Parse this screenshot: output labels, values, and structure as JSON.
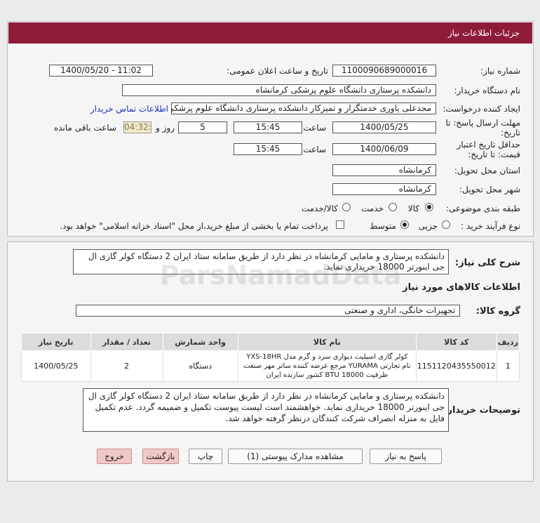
{
  "page": {
    "title": "جزئیات اطلاعات نیاز"
  },
  "form": {
    "need_number": {
      "label": "شماره نیاز:",
      "value": "1100090689000016"
    },
    "announce_datetime": {
      "label": "تاریخ و ساعت اعلان عمومی:",
      "value": "1400/05/20 - 11:02"
    },
    "buyer_org": {
      "label": "نام دستگاه خریدار:",
      "value": "دانشکده پرستاری دانشگاه علوم پزشکی کرمانشاه"
    },
    "requester": {
      "label": "ایجاد کننده درخواست:",
      "value": "مجدعلی یاوری خدمتگزار و تمیزکار دانشکده پرستاری دانشگاه علوم پزشکی کرم",
      "contact_link": "اطلاعات تماس خریدار"
    },
    "reply_deadline": {
      "label_line1": "مهلت ارسال پاسخ: تا",
      "label_line2": "تاریخ:",
      "date": "1400/05/25",
      "time_label": "ساعت",
      "time": "15:45",
      "days": "5",
      "days_label": "روز و",
      "remaining": "04:32:52",
      "remaining_label": "ساعت باقی مانده"
    },
    "price_validity": {
      "label_line1": "حداقل تاریخ اعتبار",
      "label_line2": "قیمت: تا تاریخ:",
      "date": "1400/06/09",
      "time_label": "ساعت",
      "time": "15:45"
    },
    "delivery_province": {
      "label": "استان محل تحویل:",
      "value": "کرمانشاه"
    },
    "delivery_city": {
      "label": "شهر محل تحویل:",
      "value": "کرمانشاه"
    },
    "category": {
      "label": "طبقه بندی موضوعی:",
      "options": [
        "کالا",
        "خدمت",
        "کالا/خدمت"
      ],
      "selected": "کالا"
    },
    "purchase_process": {
      "label": "نوع فرآیند خرید :",
      "options": [
        "جزیی",
        "متوسط"
      ],
      "selected": "متوسط",
      "treasury_note": "پرداخت تمام یا بخشی از مبلغ خرید،از محل \"اسناد خزانه اسلامی\" خواهد بود."
    }
  },
  "summary": {
    "label": "شرح کلی نیاز:",
    "text": "دانشکده پرستاری و مامایی کرمانشاه در نظر دارد از طریق سامانه ستاد ایران 2 دستگاه کولر گازی ال جی اینورتر 18000 خریداری نماید."
  },
  "goods_section": {
    "title": "اطلاعات کالاهای مورد نیاز",
    "group_label": "گروه کالا:",
    "group_value": "تجهیزات خانگی، اداری و صنعتی"
  },
  "table": {
    "headers": [
      "ردیف",
      "کد کالا",
      "نام کالا",
      "واحد شمارش",
      "تعداد / مقدار",
      "تاریخ نیاز"
    ],
    "rows": [
      {
        "row": "1",
        "code": "1151120435550012",
        "name": "کولر گازی اسپلیت دیواری سرد و گرم مدل YXS-18HR نام تجارتی YURAMA مرجع عرضه کننده ساتر مهر صنعت ظرفیت BTU 18000 کشور سازنده ایران",
        "unit": "دستگاه",
        "qty": "2",
        "date": "1400/05/25"
      }
    ]
  },
  "buyer_notes": {
    "label": "توضیحات خریدار:",
    "text": "دانشکده پرستاری و مامایی کرمانشاه در نظر دارد از طریق سامانه ستاد ایران 2 دستگاه کولر گازی ال جی اینورتر 18000 خریداری نماید. خواهشمند است لیست پیوست تکمیل و ضمیمه گردد. عدم تکمیل فایل به منزله انصراف شرکت کنندگان درنظر گرفته خواهد شد."
  },
  "buttons": {
    "reply": "پاسخ به نیاز",
    "attachments": "مشاهده مدارک پیوستی (1)",
    "print": "چاپ",
    "back": "بازگشت",
    "exit": "خروج"
  },
  "watermark": "ParsNamadData"
}
